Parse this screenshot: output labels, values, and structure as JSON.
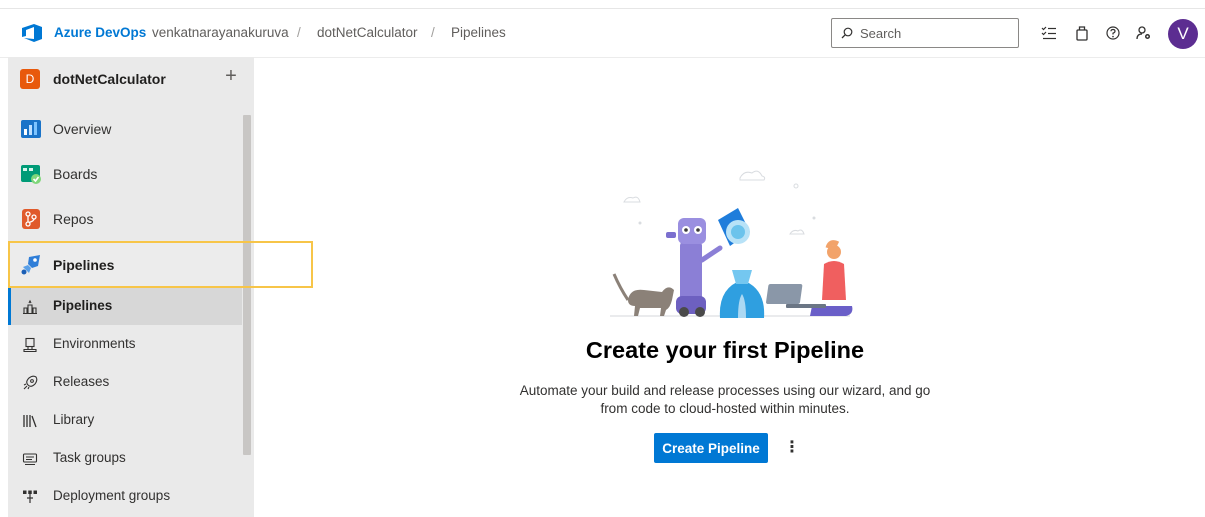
{
  "header": {
    "brand": "Azure DevOps",
    "breadcrumbs": [
      "venkatnarayanakuruva",
      "dotNetCalculator",
      "Pipelines"
    ],
    "separator": "/",
    "search_placeholder": "Search",
    "icons": [
      "task-list-icon",
      "marketplace-bag-icon",
      "help-icon",
      "user-settings-icon"
    ],
    "avatar_initial": "V",
    "colors": {
      "brand": "#0078d4",
      "avatar": "#5c2d91"
    }
  },
  "sidebar": {
    "project": {
      "initial": "D",
      "name": "dotNetCalculator",
      "add_symbol": "+"
    },
    "items": [
      {
        "label": "Overview",
        "icon": "overview-icon"
      },
      {
        "label": "Boards",
        "icon": "boards-icon"
      },
      {
        "label": "Repos",
        "icon": "repos-icon"
      },
      {
        "label": "Pipelines",
        "icon": "pipelines-icon",
        "active": true
      }
    ],
    "subitems": [
      {
        "label": "Pipelines",
        "icon": "pipelines-sub-icon",
        "selected": true
      },
      {
        "label": "Environments",
        "icon": "environments-icon"
      },
      {
        "label": "Releases",
        "icon": "releases-icon"
      },
      {
        "label": "Library",
        "icon": "library-icon"
      },
      {
        "label": "Task groups",
        "icon": "task-groups-icon"
      },
      {
        "label": "Deployment groups",
        "icon": "deployment-groups-icon"
      }
    ]
  },
  "main": {
    "title": "Create your first Pipeline",
    "description": "Automate your build and release processes using our wizard, and go from code to cloud-hosted within minutes.",
    "create_button": "Create Pipeline",
    "more_symbol": "⋮",
    "accent_color": "#0078d4"
  }
}
